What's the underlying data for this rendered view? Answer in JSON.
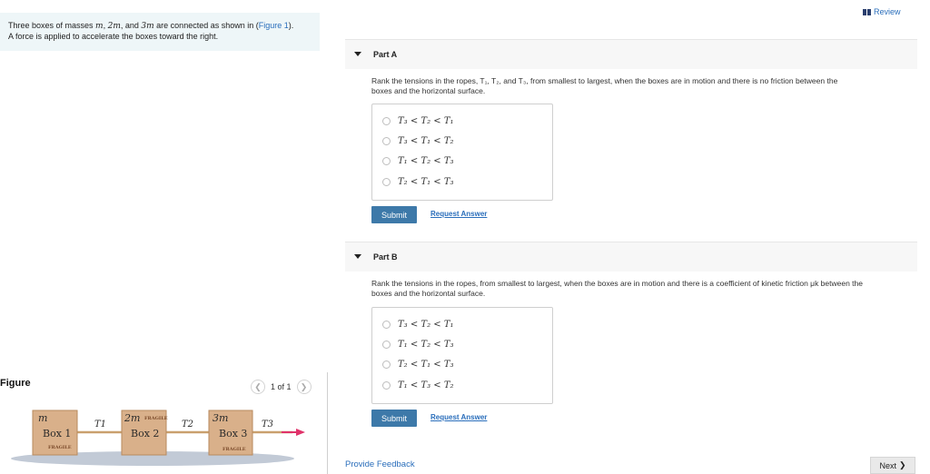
{
  "intro": {
    "line1_pre": "Three boxes of masses ",
    "m1": "m",
    "sep1": ", ",
    "m2": "2m",
    "sep2": ", and ",
    "m3": "3m",
    "line1_post": " are connected as shown in (",
    "figure_link": "Figure 1",
    "line1_end": ").",
    "line2": "A force is applied to accelerate the boxes toward the right."
  },
  "figure": {
    "title": "Figure",
    "pager_text": "1 of 1",
    "prev_icon": "chevron-left-icon",
    "next_icon": "chevron-right-icon",
    "boxes": [
      {
        "mass": "m",
        "label": "Box 1",
        "stamp": "FRAGILE"
      },
      {
        "mass": "2m",
        "label": "Box 2",
        "stamp": "FRAGILE"
      },
      {
        "mass": "3m",
        "label": "Box 3",
        "stamp": "FRAGILE"
      }
    ],
    "tensions": [
      "T1",
      "T2",
      "T3"
    ],
    "colors": {
      "box": "#d9b08a",
      "rope": "#c9a06e",
      "arrow": "#e0336a",
      "floor": "#c2cad6"
    }
  },
  "header": {
    "review": "Review",
    "review_icon": "bookmark-icon"
  },
  "partA": {
    "arrow_icon": "caret-down-icon",
    "title": "Part A",
    "question_l1": "Rank the tensions in the ropes, T₁, T₂, and T₃, from smallest to largest, when the boxes are in motion and there is no friction between the",
    "question_l2": "boxes and the horizontal surface.",
    "choices": [
      "T₃ < T₂ < T₁",
      "T₃ < T₁ < T₂",
      "T₁ < T₂ < T₃",
      "T₂ < T₁ < T₃"
    ],
    "submit": "Submit",
    "request": "Request Answer"
  },
  "partB": {
    "arrow_icon": "caret-down-icon",
    "title": "Part B",
    "question_l1": "Rank the tensions in the ropes, from smallest to largest, when the boxes are in motion and there is a coefficient of kinetic friction μk between the",
    "question_l2": "boxes and the horizontal surface.",
    "choices": [
      "T₃ < T₂ < T₁",
      "T₁ < T₂ < T₃",
      "T₂ < T₁ < T₃",
      "T₁ < T₃ < T₂"
    ],
    "submit": "Submit",
    "request": "Request Answer"
  },
  "footer": {
    "feedback": "Provide Feedback",
    "next": "Next",
    "next_icon": "chevron-right-icon"
  }
}
